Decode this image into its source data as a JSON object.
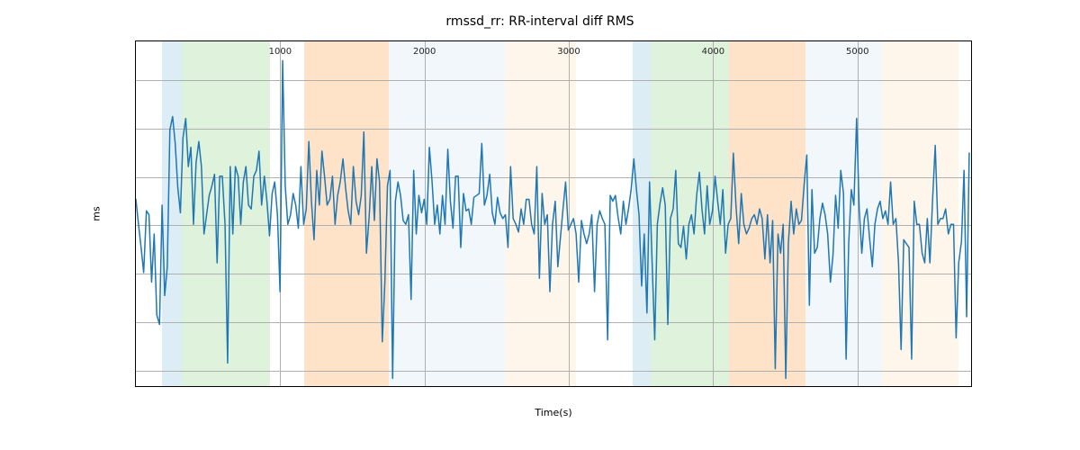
{
  "chart_data": {
    "type": "line",
    "title": "rmssd_rr: RR-interval diff RMS",
    "xlabel": "Time(s)",
    "ylabel": "ms",
    "xlim": [
      0,
      5800
    ],
    "ylim": [
      16,
      195
    ],
    "xticks": [
      1000,
      2000,
      3000,
      4000,
      5000
    ],
    "yticks": [
      25,
      50,
      75,
      100,
      125,
      150,
      175
    ],
    "spans": [
      {
        "x0": 180,
        "x1": 320,
        "color": "#9ecae1"
      },
      {
        "x0": 320,
        "x1": 930,
        "color": "#a1d99b"
      },
      {
        "x0": 1165,
        "x1": 1750,
        "color": "#fdae61"
      },
      {
        "x0": 1750,
        "x1": 2560,
        "color": "#d6e9f4"
      },
      {
        "x0": 2560,
        "x1": 3050,
        "color": "#fde4c3"
      },
      {
        "x0": 3440,
        "x1": 3570,
        "color": "#9ecae1"
      },
      {
        "x0": 3570,
        "x1": 4110,
        "color": "#a1d99b"
      },
      {
        "x0": 4110,
        "x1": 4640,
        "color": "#fdae61"
      },
      {
        "x0": 4640,
        "x1": 5170,
        "color": "#d6e9f4"
      },
      {
        "x0": 5170,
        "x1": 5700,
        "color": "#fde4c3"
      }
    ],
    "series": [
      {
        "name": "rmssd_rr",
        "color": "#1f77b4",
        "x": [
          0,
          18,
          36,
          54,
          73,
          91,
          109,
          127,
          145,
          164,
          182,
          200,
          218,
          236,
          255,
          273,
          291,
          309,
          327,
          346,
          364,
          382,
          400,
          418,
          437,
          455,
          473,
          491,
          509,
          528,
          546,
          564,
          582,
          600,
          619,
          637,
          655,
          673,
          691,
          710,
          728,
          746,
          764,
          782,
          801,
          819,
          837,
          855,
          873,
          892,
          910,
          928,
          946,
          964,
          983,
          1001,
          1019,
          1037,
          1055,
          1074,
          1092,
          1110,
          1128,
          1146,
          1165,
          1183,
          1201,
          1219,
          1237,
          1256,
          1274,
          1292,
          1310,
          1328,
          1347,
          1365,
          1383,
          1401,
          1419,
          1438,
          1456,
          1474,
          1492,
          1510,
          1529,
          1547,
          1565,
          1583,
          1601,
          1620,
          1638,
          1656,
          1674,
          1692,
          1711,
          1729,
          1747,
          1765,
          1783,
          1802,
          1820,
          1838,
          1856,
          1874,
          1893,
          1911,
          1929,
          1947,
          1965,
          1984,
          2002,
          2020,
          2038,
          2056,
          2075,
          2093,
          2111,
          2129,
          2147,
          2166,
          2184,
          2202,
          2220,
          2238,
          2256,
          2275,
          2293,
          2311,
          2329,
          2347,
          2366,
          2384,
          2402,
          2420,
          2438,
          2457,
          2475,
          2493,
          2511,
          2529,
          2548,
          2566,
          2584,
          2602,
          2620,
          2639,
          2657,
          2675,
          2693,
          2711,
          2730,
          2748,
          2766,
          2784,
          2802,
          2821,
          2839,
          2857,
          2875,
          2893,
          2912,
          2930,
          2948,
          2966,
          2984,
          3003,
          3021,
          3039,
          3057,
          3075,
          3094,
          3112,
          3130,
          3148,
          3166,
          3185,
          3203,
          3221,
          3239,
          3257,
          3276,
          3294,
          3312,
          3330,
          3348,
          3367,
          3385,
          3403,
          3421,
          3439,
          3458,
          3476,
          3494,
          3512,
          3530,
          3549,
          3567,
          3585,
          3603,
          3621,
          3640,
          3658,
          3676,
          3694,
          3712,
          3731,
          3749,
          3767,
          3785,
          3803,
          3822,
          3840,
          3858,
          3876,
          3894,
          3913,
          3931,
          3949,
          3967,
          3985,
          4004,
          4022,
          4040,
          4058,
          4076,
          4095,
          4113,
          4131,
          4149,
          4167,
          4186,
          4204,
          4222,
          4240,
          4258,
          4277,
          4295,
          4313,
          4331,
          4349,
          4368,
          4386,
          4404,
          4422,
          4440,
          4459,
          4477,
          4495,
          4513,
          4531,
          4550,
          4568,
          4586,
          4604,
          4622,
          4641,
          4659,
          4677,
          4695,
          4713,
          4732,
          4750,
          4768,
          4786,
          4804,
          4823,
          4841,
          4859,
          4877,
          4895,
          4914,
          4932,
          4950,
          4968,
          4986,
          5005,
          5023,
          5041,
          5059,
          5077,
          5096,
          5114,
          5132,
          5150,
          5168,
          5187,
          5205,
          5223,
          5241,
          5259,
          5278,
          5296,
          5314,
          5332,
          5350,
          5369,
          5387,
          5405,
          5423,
          5441,
          5460,
          5478,
          5496,
          5514,
          5532,
          5551,
          5569,
          5587,
          5605,
          5623,
          5642,
          5660,
          5678,
          5696,
          5714,
          5733,
          5751,
          5769,
          5787
        ],
        "y": [
          113,
          100,
          88,
          75,
          107,
          105,
          70,
          95,
          53,
          48,
          110,
          63,
          78,
          149,
          156,
          142,
          119,
          106,
          145,
          155,
          130,
          140,
          100,
          132,
          143,
          130,
          95,
          105,
          115,
          120,
          126,
          80,
          125,
          125,
          100,
          28,
          130,
          95,
          130,
          125,
          100,
          122,
          130,
          110,
          108,
          125,
          128,
          138,
          110,
          125,
          112,
          94,
          116,
          122,
          105,
          65,
          185,
          120,
          100,
          105,
          116,
          110,
          98,
          130,
          100,
          108,
          143,
          112,
          92,
          128,
          110,
          138,
          125,
          110,
          113,
          125,
          100,
          115,
          122,
          134,
          119,
          107,
          100,
          130,
          112,
          105,
          115,
          148,
          85,
          104,
          130,
          102,
          134,
          122,
          39,
          70,
          120,
          128,
          20,
          112,
          122,
          115,
          102,
          100,
          105,
          61,
          128,
          95,
          115,
          106,
          113,
          100,
          140,
          123,
          100,
          110,
          95,
          115,
          100,
          139,
          112,
          98,
          125,
          125,
          88,
          116,
          107,
          108,
          100,
          114,
          115,
          116,
          142,
          110,
          115,
          126,
          106,
          100,
          114,
          106,
          103,
          105,
          88,
          130,
          103,
          100,
          96,
          108,
          100,
          113,
          113,
          100,
          95,
          130,
          72,
          116,
          100,
          105,
          65,
          100,
          112,
          78,
          93,
          108,
          122,
          97,
          100,
          103,
          95,
          70,
          102,
          95,
          90,
          95,
          105,
          65,
          100,
          107,
          103,
          100,
          40,
          115,
          112,
          115,
          104,
          95,
          112,
          100,
          108,
          118,
          134,
          118,
          105,
          68,
          95,
          54,
          122,
          80,
          40,
          100,
          111,
          119,
          110,
          48,
          103,
          108,
          128,
          90,
          88,
          99,
          82,
          100,
          105,
          95,
          115,
          127,
          108,
          95,
          120,
          100,
          107,
          125,
          112,
          100,
          118,
          85,
          100,
          103,
          137,
          110,
          90,
          116,
          100,
          95,
          98,
          103,
          105,
          100,
          108,
          103,
          82,
          105,
          80,
          102,
          25,
          95,
          85,
          100,
          20,
          90,
          112,
          95,
          108,
          100,
          102,
          121,
          136,
          58,
          118,
          85,
          88,
          103,
          111,
          105,
          95,
          70,
          84,
          115,
          98,
          128,
          116,
          30,
          90,
          118,
          110,
          155,
          108,
          85,
          103,
          108,
          92,
          78,
          100,
          108,
          112,
          103,
          107,
          100,
          122,
          100,
          103,
          80,
          35,
          92,
          90,
          88,
          30,
          112,
          100,
          100,
          85,
          80,
          103,
          80,
          112,
          141,
          100,
          103,
          103,
          108,
          95,
          100,
          100,
          41,
          80,
          91,
          128,
          52,
          137,
          23
        ]
      }
    ]
  }
}
